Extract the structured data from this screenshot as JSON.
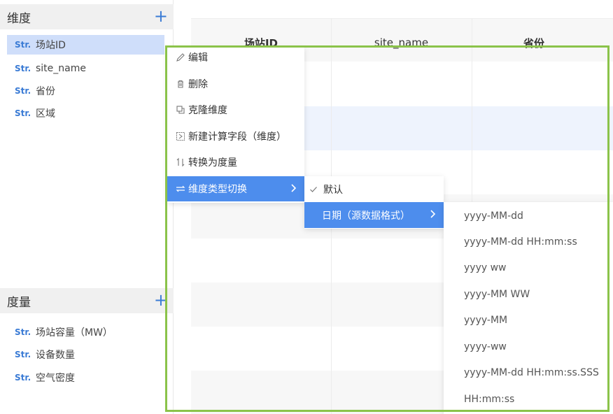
{
  "dimensions": {
    "title": "维度",
    "fields": [
      {
        "type": "Str.",
        "name": "场站ID"
      },
      {
        "type": "Str.",
        "name": "site_name"
      },
      {
        "type": "Str.",
        "name": "省份"
      },
      {
        "type": "Str.",
        "name": "区域"
      }
    ]
  },
  "measures": {
    "title": "度量",
    "fields": [
      {
        "type": "Str.",
        "name": "场站容量（MW）"
      },
      {
        "type": "Str.",
        "name": "设备数量"
      },
      {
        "type": "Str.",
        "name": "空气密度"
      }
    ]
  },
  "add_label": "+",
  "table": {
    "headers": [
      "场站ID",
      "site_name",
      "省份"
    ]
  },
  "context_menu": {
    "items": [
      {
        "icon": "pencil-icon",
        "label": "编辑"
      },
      {
        "icon": "trash-icon",
        "label": "删除"
      },
      {
        "icon": "copy-icon",
        "label": "克隆维度"
      },
      {
        "icon": "calc-field-icon",
        "label": "新建计算字段（维度）"
      },
      {
        "icon": "swap-vertical-icon",
        "label": "转换为度量"
      },
      {
        "icon": "swap-horizontal-icon",
        "label": "维度类型切换"
      }
    ]
  },
  "type_submenu": {
    "items": [
      {
        "label": "默认",
        "checked": true
      },
      {
        "label": "日期（源数据格式）",
        "checked": false
      }
    ]
  },
  "date_formats": [
    "yyyy-MM-dd",
    "yyyy-MM-dd HH:mm:ss",
    "yyyy ww",
    "yyyy-MM WW",
    "yyyy-MM",
    "yyyy-ww",
    "yyyy-MM-dd HH:mm:ss.SSS",
    "HH:mm:ss"
  ],
  "colors": {
    "accent": "#4d8ded",
    "selected_field": "#cfdefa",
    "frame": "#8bc34a"
  }
}
